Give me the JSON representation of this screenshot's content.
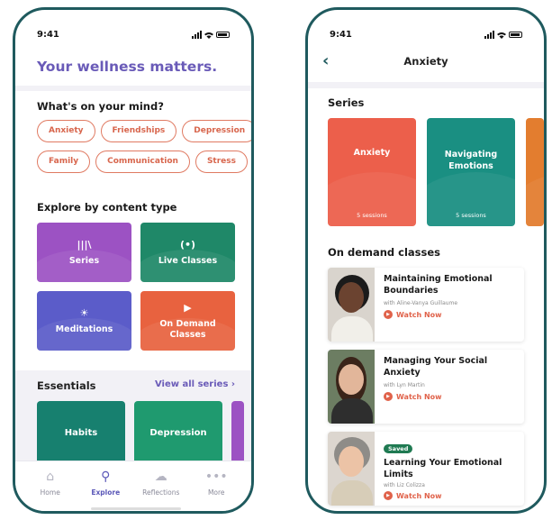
{
  "left": {
    "status": {
      "time": "9:41"
    },
    "header": "Your wellness matters.",
    "mind": {
      "title": "What's on your mind?",
      "row1": [
        "Anxiety",
        "Friendships",
        "Depression"
      ],
      "row2": [
        "Family",
        "Communication",
        "Stress"
      ]
    },
    "explore": {
      "title": "Explore by content type",
      "tiles": [
        {
          "label": "Series",
          "icon": "library-icon"
        },
        {
          "label": "Live Classes",
          "icon": "broadcast-icon"
        },
        {
          "label": "Meditations",
          "icon": "sun-icon"
        },
        {
          "label": "On Demand Classes",
          "icon": "play-circle-icon"
        }
      ]
    },
    "essentials": {
      "title": "Essentials",
      "link": "View all series",
      "cards": [
        "Habits",
        "Depression"
      ]
    },
    "tabs": [
      {
        "label": "Home",
        "icon": "home-icon"
      },
      {
        "label": "Explore",
        "icon": "search-icon"
      },
      {
        "label": "Reflections",
        "icon": "cloud-icon"
      },
      {
        "label": "More",
        "icon": "more-icon"
      }
    ]
  },
  "right": {
    "status": {
      "time": "9:41"
    },
    "title": "Anxiety",
    "series_title": "Series",
    "series": [
      {
        "name": "Anxiety",
        "sessions": "5 sessions"
      },
      {
        "name": "Navigating Emotions",
        "sessions": "5 sessions"
      }
    ],
    "ondemand_title": "On demand classes",
    "classes": [
      {
        "title": "Maintaining Emotional Boundaries",
        "with": "with Aline-Vanya Guillaume",
        "watch": "Watch Now",
        "saved": ""
      },
      {
        "title": "Managing Your Social Anxiety",
        "with": "with Lyn Martin",
        "watch": "Watch Now",
        "saved": ""
      },
      {
        "title": "Learning Your Emotional Limits",
        "with": "with Liz Colizza",
        "watch": "Watch Now",
        "saved": "Saved"
      }
    ]
  },
  "colors": {
    "brand": "#6a5bb8",
    "frame": "#1f5a5e",
    "chip": "#e07a62",
    "accent": "#e0624a"
  }
}
